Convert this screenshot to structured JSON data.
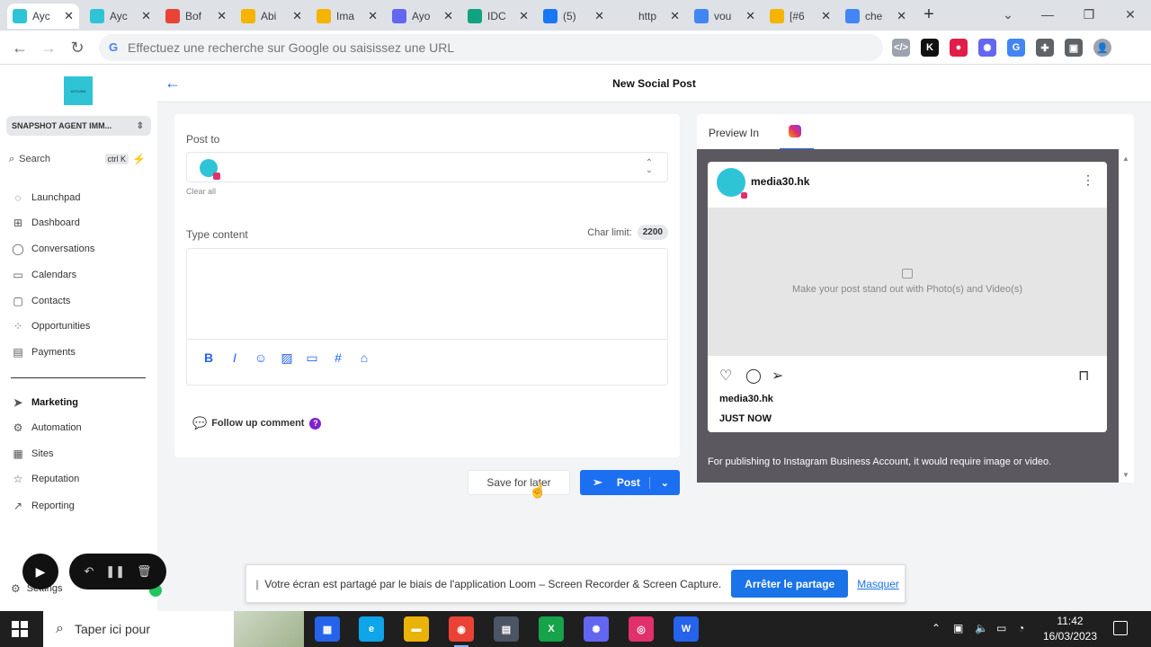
{
  "browser": {
    "tabs": [
      {
        "label": "Ayc",
        "color": "#2ec4d6",
        "icon": "app-icon",
        "active": true
      },
      {
        "label": "Ayc",
        "color": "#2ec4d6",
        "icon": "app-icon"
      },
      {
        "label": "Bof",
        "color": "#ea4335",
        "icon": "gmail-icon"
      },
      {
        "label": "Abi",
        "color": "#f4b400",
        "icon": "analytics-icon"
      },
      {
        "label": "Ima",
        "color": "#f4b400",
        "icon": "analytics-icon"
      },
      {
        "label": "Ayo",
        "color": "#6366f1",
        "icon": "spark-icon"
      },
      {
        "label": "IDC",
        "color": "#10a37f",
        "icon": "openai-icon"
      },
      {
        "label": "(5)",
        "color": "#1877f2",
        "icon": "facebook-icon"
      },
      {
        "label": "http",
        "color": "#dee1e6",
        "icon": "blank-icon"
      },
      {
        "label": "vou",
        "color": "#4285f4",
        "icon": "google-icon"
      },
      {
        "label": "[#6",
        "color": "#f4b400",
        "icon": "analytics-icon"
      },
      {
        "label": "che",
        "color": "#4285f4",
        "icon": "google-icon"
      }
    ],
    "new_tab": "+",
    "window_controls": {
      "chevron": "⌄",
      "minimize": "—",
      "restore": "❐",
      "close": "✕"
    },
    "omnibox_placeholder": "Effectuez une recherche sur Google ou saisissez une URL",
    "extensions": [
      {
        "name": "code-ext-icon",
        "label": "</>",
        "color": "#9ca3af"
      },
      {
        "name": "k-ext-icon",
        "label": "K",
        "color": "#111111"
      },
      {
        "name": "red-ext-icon",
        "label": "●",
        "color": "#e11d48"
      },
      {
        "name": "spark-ext-icon",
        "label": "✺",
        "color": "#6366f1"
      },
      {
        "name": "translate-ext-icon",
        "label": "G",
        "color": "#4285f4"
      },
      {
        "name": "puzzle-ext-icon",
        "label": "✚",
        "color": "#5f6368"
      },
      {
        "name": "sidepanel-ext-icon",
        "label": "▣",
        "color": "#5f6368"
      },
      {
        "name": "profile-avatar",
        "label": "👤",
        "color": "#9ca3af"
      }
    ]
  },
  "sidebar": {
    "logo_text": "AYOUNN",
    "location": "SNAPSHOT AGENT IMM...",
    "search_label": "Search",
    "search_shortcut": "ctrl K",
    "items": [
      {
        "label": "Launchpad",
        "icon": "launchpad-icon",
        "glyph": "◌"
      },
      {
        "label": "Dashboard",
        "icon": "dashboard-icon",
        "glyph": "⊞"
      },
      {
        "label": "Conversations",
        "icon": "chat-icon",
        "glyph": "◯"
      },
      {
        "label": "Calendars",
        "icon": "calendar-icon",
        "glyph": "▭"
      },
      {
        "label": "Contacts",
        "icon": "contacts-icon",
        "glyph": "▢"
      },
      {
        "label": "Opportunities",
        "icon": "opportunities-icon",
        "glyph": "⁘"
      },
      {
        "label": "Payments",
        "icon": "payments-icon",
        "glyph": "▤"
      },
      {
        "label": "Marketing",
        "icon": "send-icon",
        "glyph": "➤",
        "active": true
      },
      {
        "label": "Automation",
        "icon": "automation-icon",
        "glyph": "⚙"
      },
      {
        "label": "Sites",
        "icon": "sites-icon",
        "glyph": "▦"
      },
      {
        "label": "Reputation",
        "icon": "star-icon",
        "glyph": "☆"
      },
      {
        "label": "Reporting",
        "icon": "reporting-icon",
        "glyph": "↗"
      }
    ],
    "settings_label": "Settings"
  },
  "page": {
    "title": "New Social Post",
    "post_to_label": "Post to",
    "clear_all": "Clear all",
    "type_content_label": "Type content",
    "char_limit_label": "Char limit:",
    "char_limit_value": "2200",
    "tools": [
      {
        "name": "bold-tool-icon",
        "glyph": "B"
      },
      {
        "name": "italic-tool-icon",
        "glyph": "I"
      },
      {
        "name": "emoji-tool-icon",
        "glyph": "☺"
      },
      {
        "name": "image-tool-icon",
        "glyph": "▨"
      },
      {
        "name": "video-tool-icon",
        "glyph": "▭"
      },
      {
        "name": "hashtag-tool-icon",
        "glyph": "#"
      },
      {
        "name": "tag-tool-icon",
        "glyph": "⌂"
      }
    ],
    "follow_up_label": "Follow up comment",
    "save_label": "Save for later",
    "post_label": "Post"
  },
  "preview": {
    "label": "Preview In",
    "username": "media30.hk",
    "media_placeholder": "Make your post stand out with Photo(s) and Video(s)",
    "caption_user": "media30.hk",
    "timestamp": "JUST NOW",
    "note": "For publishing to Instagram Business Account, it would require image or video."
  },
  "share_bar": {
    "message": "Votre écran est partagé par le biais de l'application Loom – Screen Recorder & Screen Capture.",
    "stop_label": "Arrêter le partage",
    "hide_label": "Masquer"
  },
  "taskbar": {
    "search_placeholder": "Taper ici pour",
    "time": "11:42",
    "date": "16/03/2023",
    "apps": [
      {
        "name": "taskview-app-icon",
        "glyph": "▦",
        "color": "#2563eb"
      },
      {
        "name": "edge-app-icon",
        "glyph": "e",
        "color": "#0ea5e9"
      },
      {
        "name": "explorer-app-icon",
        "glyph": "▬",
        "color": "#eab308"
      },
      {
        "name": "chrome-app-icon",
        "glyph": "◉",
        "color": "#ea4335"
      },
      {
        "name": "calculator-app-icon",
        "glyph": "▤",
        "color": "#4b5563"
      },
      {
        "name": "excel-app-icon",
        "glyph": "X",
        "color": "#16a34a"
      },
      {
        "name": "spark-app-icon",
        "glyph": "✺",
        "color": "#6366f1"
      },
      {
        "name": "instagram-app-icon",
        "glyph": "◎",
        "color": "#e1306c"
      },
      {
        "name": "word-app-icon",
        "glyph": "W",
        "color": "#2563eb"
      }
    ]
  }
}
